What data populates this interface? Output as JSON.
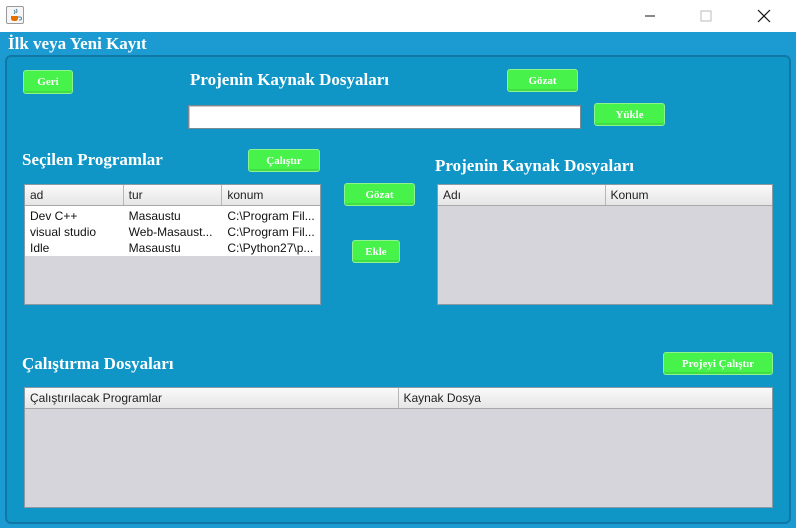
{
  "window": {
    "app_icon": "java-cup-icon",
    "minimize_icon": "minimize-icon",
    "maximize_icon": "maximize-icon",
    "close_icon": "close-icon"
  },
  "frame_title": "İlk veya Yeni Kayıt",
  "top": {
    "back_button": "Geri",
    "title": "Projenin Kaynak Dosyaları",
    "browse_button": "Gözat",
    "path_value": "",
    "upload_button": "Yükle"
  },
  "selected_programs": {
    "title": "Seçilen Programlar",
    "run_button": "Çalıştır",
    "columns": [
      "ad",
      "tur",
      "konum"
    ],
    "rows": [
      [
        "Dev C++",
        "Masaustu",
        "C:\\Program Fil..."
      ],
      [
        "visual studio",
        "Web-Masaust...",
        "C:\\Program Fil..."
      ],
      [
        "Idle",
        "Masaustu",
        "C:\\Python27\\p..."
      ]
    ]
  },
  "middle": {
    "browse_button": "Gözat",
    "add_button": "Ekle"
  },
  "source_files": {
    "title": "Projenin Kaynak Dosyaları",
    "columns": [
      "Adı",
      "Konum"
    ]
  },
  "run_files": {
    "title": "Çalıştırma Dosyaları",
    "run_project_button": "Projeyi Çalıştır",
    "columns": [
      "Çalıştırılacak Programlar",
      "Kaynak Dosya"
    ]
  },
  "colors": {
    "background": "#1b9bd1",
    "button": "#47f24a",
    "table_body": "#d5d5db"
  }
}
